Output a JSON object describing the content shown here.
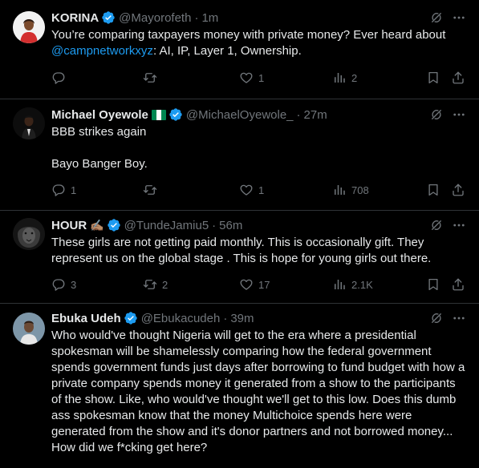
{
  "tweets": [
    {
      "name": "KORINA",
      "handle": "@Mayorofeth",
      "time": "1m",
      "body_pre": "You’re comparing taxpayers money with private money? Ever heard about ",
      "body_link": "@campnetworkxyz",
      "body_post": ": AI, IP, Layer 1, Ownership.",
      "replies": "",
      "retweets": "",
      "likes": "1",
      "views": "2"
    },
    {
      "name": "Michael Oyewole",
      "flag_emoji": "🇳🇬",
      "handle": "@MichaelOyewole_",
      "time": "27m",
      "line1": "BBB strikes again",
      "line2": "Bayo Banger Boy.",
      "replies": "1",
      "retweets": "",
      "likes": "1",
      "views": "708"
    },
    {
      "name": "HOUR",
      "hand_emoji": "✍🏽",
      "handle": "@TundeJamiu5",
      "time": "56m",
      "body": "These girls are not getting paid monthly. This is occasionally gift. They represent us on the global stage . This is hope for young girls out there.",
      "replies": "3",
      "retweets": "2",
      "likes": "17",
      "views": "2.1K"
    },
    {
      "name": "Ebuka Udeh",
      "handle": "@Ebukacudeh",
      "time": "39m",
      "body": "Who would've thought Nigeria will get to the era where a presidential spokesman will be shamelessly comparing how the federal government spends government funds just days after borrowing to fund budget with how a private company spends money it generated from a show to the participants of the show. Like, who would've thought we'll get to this low. Does this dumb ass spokesman know that the money Multichoice spends here were generated from the show and it's donor partners and not borrowed money... How did we f*cking get here?"
    }
  ],
  "dot": "·",
  "colors": {
    "accent": "#1d9bf0",
    "muted": "#71767b",
    "text": "#e7e9ea",
    "background": "#000000",
    "divider": "#2f3336"
  }
}
